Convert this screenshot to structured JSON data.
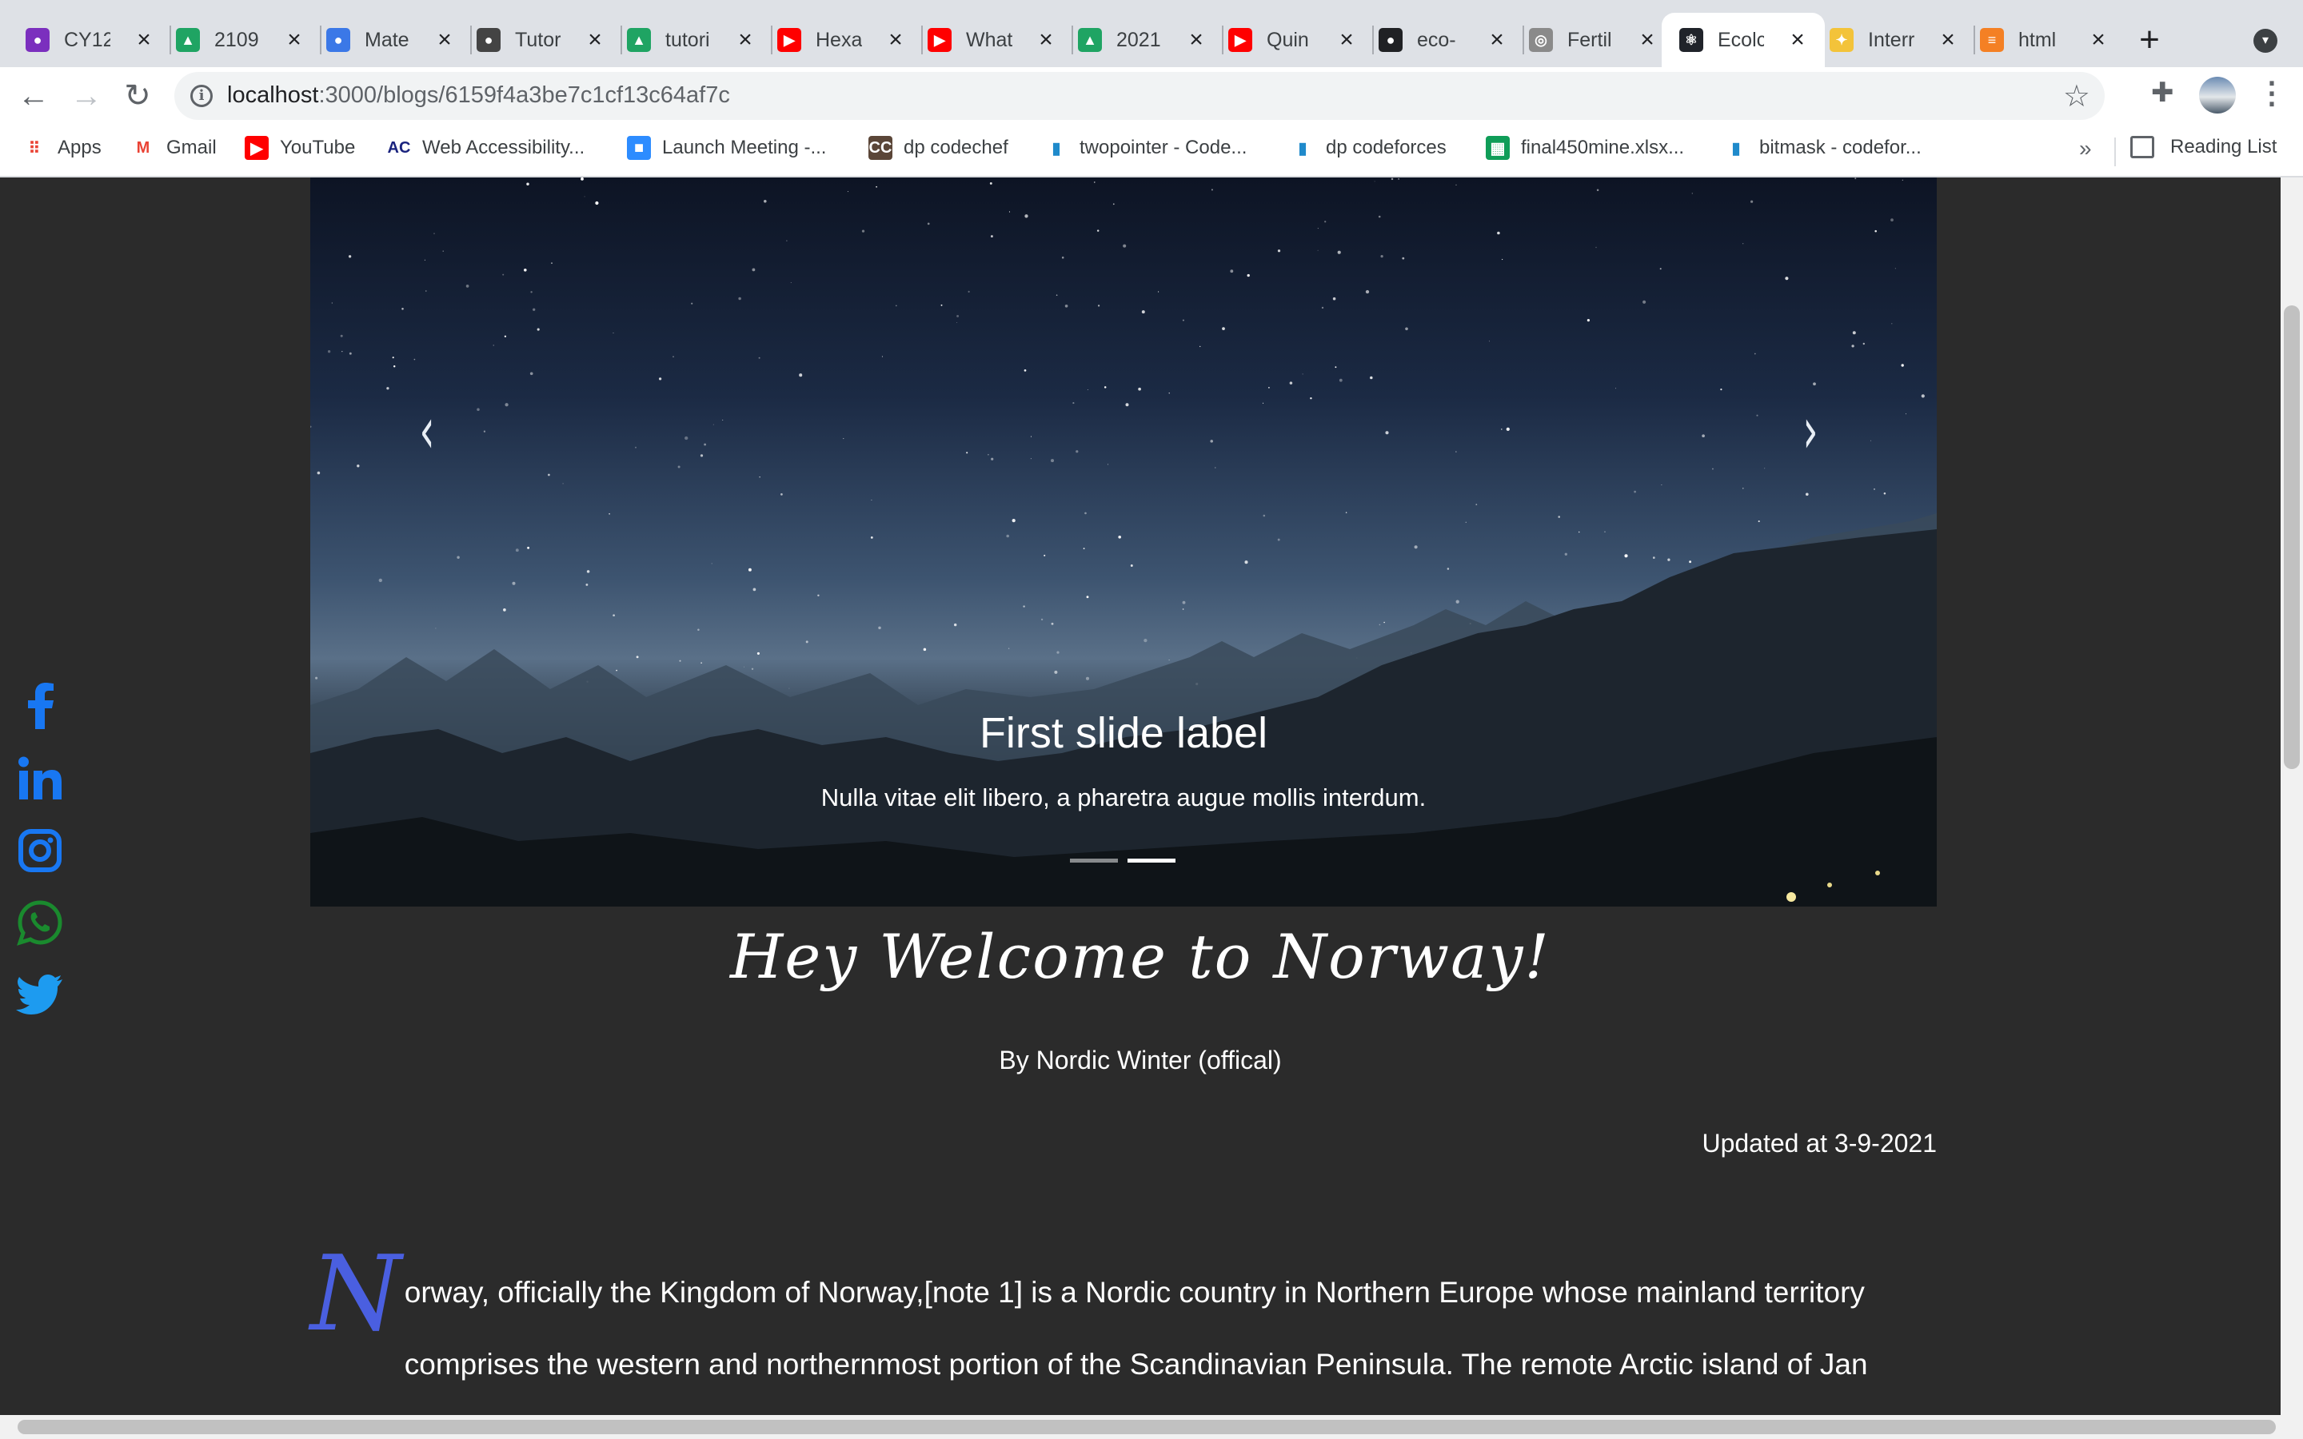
{
  "browser": {
    "tabs": [
      {
        "title": "CY12",
        "icon": "classroom-icon",
        "color": "#7b2fbe"
      },
      {
        "title": "2109",
        "icon": "google-drive-icon",
        "color": "#1fa463"
      },
      {
        "title": "Mate",
        "icon": "classroom-icon",
        "color": "#3b78e7"
      },
      {
        "title": "Tutor",
        "icon": "classroom-icon",
        "color": "#444444"
      },
      {
        "title": "tutori",
        "icon": "google-drive-icon",
        "color": "#1fa463"
      },
      {
        "title": "Hexa",
        "icon": "youtube-icon",
        "color": "#ff0000"
      },
      {
        "title": "What",
        "icon": "youtube-icon",
        "color": "#ff0000"
      },
      {
        "title": "2021",
        "icon": "google-drive-icon",
        "color": "#1fa463"
      },
      {
        "title": "Quin",
        "icon": "youtube-icon",
        "color": "#ff0000"
      },
      {
        "title": "eco-",
        "icon": "github-icon",
        "color": "#202124"
      },
      {
        "title": "Fertil",
        "icon": "globe-icon",
        "color": "#8a8a8a"
      },
      {
        "title": "Ecolc",
        "icon": "react-icon",
        "color": "#20232a",
        "active": true
      },
      {
        "title": "Interr",
        "icon": "codechef-icon",
        "color": "#f3c33a"
      },
      {
        "title": "html",
        "icon": "stackoverflow-icon",
        "color": "#f48024"
      }
    ],
    "url_host": "localhost",
    "url_path": ":3000/blogs/6159f4a3be7c1cf13c64af7c",
    "bookmarks": [
      {
        "label": "Apps",
        "icon": "apps-grid-icon"
      },
      {
        "label": "Gmail",
        "icon": "gmail-icon"
      },
      {
        "label": "YouTube",
        "icon": "youtube-icon"
      },
      {
        "label": "Web Accessibility...",
        "icon": "ac-icon"
      },
      {
        "label": "Launch Meeting -...",
        "icon": "zoom-icon"
      },
      {
        "label": "dp codechef",
        "icon": "codechef-icon"
      },
      {
        "label": "twopointer - Code...",
        "icon": "codeforces-icon"
      },
      {
        "label": "dp codeforces",
        "icon": "codeforces-icon"
      },
      {
        "label": "final450mine.xlsx...",
        "icon": "sheets-icon"
      },
      {
        "label": "bitmask - codefor...",
        "icon": "codeforces-icon"
      }
    ],
    "bookmarks_more": "»",
    "reading_list": "Reading List"
  },
  "carousel": {
    "caption_title": "First slide label",
    "caption_text": "Nulla vitae elit libero, a pharetra augue mollis interdum.",
    "active_indicator": 2,
    "indicator_count": 2
  },
  "blog": {
    "title": "Hey Welcome to Norway!",
    "author": "By Nordic Winter (offical)",
    "updated": "Updated at 3-9-2021",
    "dropcap": "N",
    "body": "orway, officially the Kingdom of Norway,[note 1] is a Nordic country in Northern Europe whose mainland territory comprises the western and northernmost portion of the Scandinavian Peninsula. The remote Arctic island of Jan"
  },
  "social": [
    {
      "name": "facebook-icon",
      "color": "#1877f2"
    },
    {
      "name": "linkedin-icon",
      "color": "#1877f2"
    },
    {
      "name": "instagram-icon",
      "color": "#1877f2"
    },
    {
      "name": "whatsapp-icon",
      "color": "#1a8a2e"
    },
    {
      "name": "twitter-icon",
      "color": "#1d9bf0"
    }
  ],
  "colors": {
    "page_bg": "#2b2b2b",
    "dropcap": "#4a5fe0"
  }
}
